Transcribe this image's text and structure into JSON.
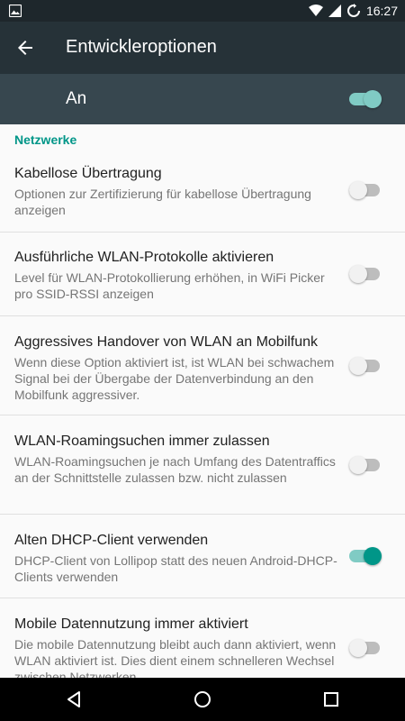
{
  "status_bar": {
    "time": "16:27",
    "icons": [
      "image-icon",
      "wifi-icon",
      "signal-icon",
      "sync-icon"
    ]
  },
  "app_bar": {
    "title": "Entwickleroptionen"
  },
  "master_switch": {
    "label": "An",
    "state": true
  },
  "section": {
    "header": "Netzwerke"
  },
  "settings": [
    {
      "title": "Kabellose Übertragung",
      "summary": "Optionen zur Zertifizierung für kabellose Übertragung anzeigen",
      "enabled": false
    },
    {
      "title": "Ausführliche WLAN-Protokolle aktivieren",
      "summary": "Level für WLAN-Protokollierung erhöhen, in WiFi Picker pro SSID-RSSI anzeigen",
      "enabled": false
    },
    {
      "title": "Aggressives Handover von WLAN an Mobilfunk",
      "summary": "Wenn diese Option aktiviert ist, ist WLAN bei schwachem Signal bei der Übergabe der Datenverbindung an den Mobilfunk aggressiver.",
      "enabled": false
    },
    {
      "title": "WLAN-Roamingsuchen immer zulassen",
      "summary": "WLAN-Roamingsuchen je nach Umfang des Datentraffics an der Schnittstelle zulassen bzw. nicht zulassen",
      "enabled": false
    },
    {
      "title": "Alten DHCP-Client verwenden",
      "summary": "DHCP-Client von Lollipop statt des neuen Android-DHCP-Clients verwenden",
      "enabled": true
    },
    {
      "title": "Mobile Datennutzung immer aktiviert",
      "summary": "Die mobile Datennutzung bleibt auch dann aktiviert, wenn WLAN aktiviert ist. Dies dient einem schnelleren Wechsel zwischen Netzwerken.",
      "enabled": false
    }
  ],
  "colors": {
    "accent": "#009688",
    "accent_track": "#80cbc4",
    "app_bar": "#263238",
    "master_bar": "#37474f",
    "status_bar": "#1e272c"
  },
  "nav_bar": {
    "buttons": [
      "back-icon",
      "home-icon",
      "recents-icon"
    ]
  }
}
